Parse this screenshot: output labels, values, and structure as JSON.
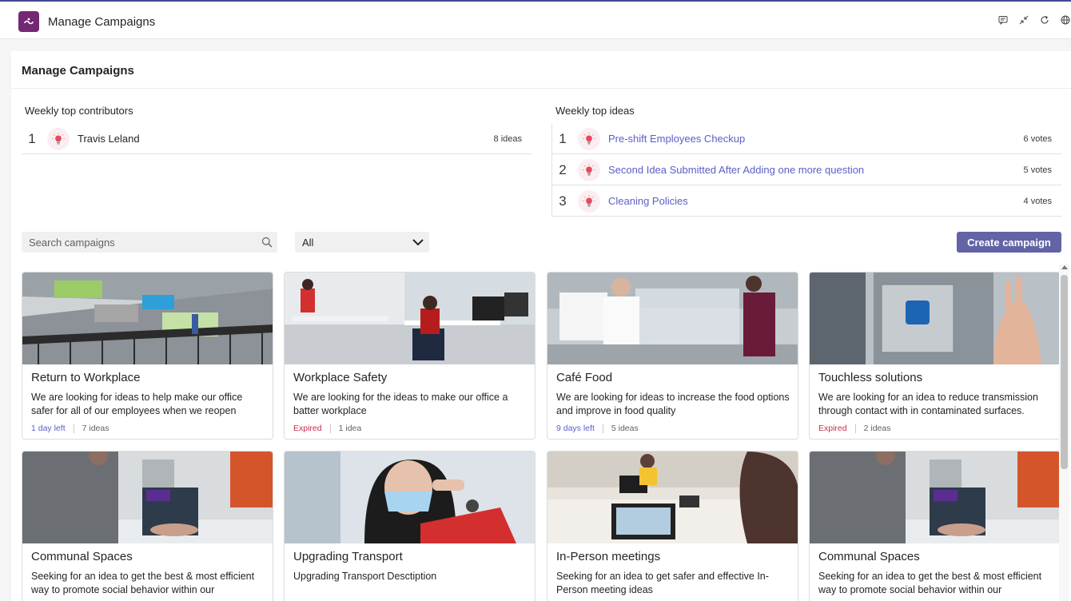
{
  "app": {
    "title": "Manage Campaigns"
  },
  "page": {
    "title": "Manage Campaigns"
  },
  "contributors": {
    "label": "Weekly top contributors",
    "items": [
      {
        "rank": "1",
        "name": "Travis Leland",
        "count": "8 ideas"
      }
    ]
  },
  "ideas": {
    "label": "Weekly top ideas",
    "items": [
      {
        "rank": "1",
        "title": "Pre-shift Employees Checkup",
        "votes": "6 votes"
      },
      {
        "rank": "2",
        "title": "Second Idea Submitted After Adding one more question",
        "votes": "5 votes"
      },
      {
        "rank": "3",
        "title": "Cleaning Policies",
        "votes": "4 votes"
      }
    ]
  },
  "toolbar": {
    "search_placeholder": "Search campaigns",
    "filter_value": "All",
    "create_label": "Create campaign"
  },
  "campaigns": [
    {
      "title": "Return to Workplace",
      "desc": "We are looking for ideas to help make our office safer for all of our employees when we reopen",
      "status": "1 day left",
      "status_type": "left",
      "ideas": "7 ideas",
      "image": "office-lounge-image"
    },
    {
      "title": "Workplace Safety",
      "desc": "We are looking for the ideas to make our office a batter workplace",
      "status": "Expired",
      "status_type": "expired",
      "ideas": "1 idea",
      "image": "masked-office-workers-image"
    },
    {
      "title": "Café Food",
      "desc": "We are looking for ideas to increase the food options and improve in food quality",
      "status": "9 days left",
      "status_type": "left",
      "ideas": "5 ideas",
      "image": "cafe-counter-image"
    },
    {
      "title": "Touchless solutions",
      "desc": "We are looking for an idea to reduce transmission through contact with in contaminated surfaces.",
      "status": "Expired",
      "status_type": "expired",
      "ideas": "2 ideas",
      "image": "touchless-door-button-image"
    },
    {
      "title": "Communal Spaces",
      "desc": "Seeking for an idea to get the best & most efficient way to promote social behavior within our",
      "image": "handwashing-image"
    },
    {
      "title": "Upgrading Transport",
      "desc": "Upgrading Transport  Desctiption",
      "image": "masked-woman-image"
    },
    {
      "title": "In-Person meetings",
      "desc": "Seeking for an idea to get safer and effective In-Person meeting ideas",
      "image": "meeting-room-image"
    },
    {
      "title": "Communal Spaces",
      "desc": "Seeking for an idea to get the best & most efficient way to promote social behavior within our",
      "image": "handwashing-image"
    }
  ],
  "colors": {
    "accent": "#6264a7",
    "link": "#5b5fc7",
    "expired": "#c4314b",
    "app_icon": "#742774"
  }
}
